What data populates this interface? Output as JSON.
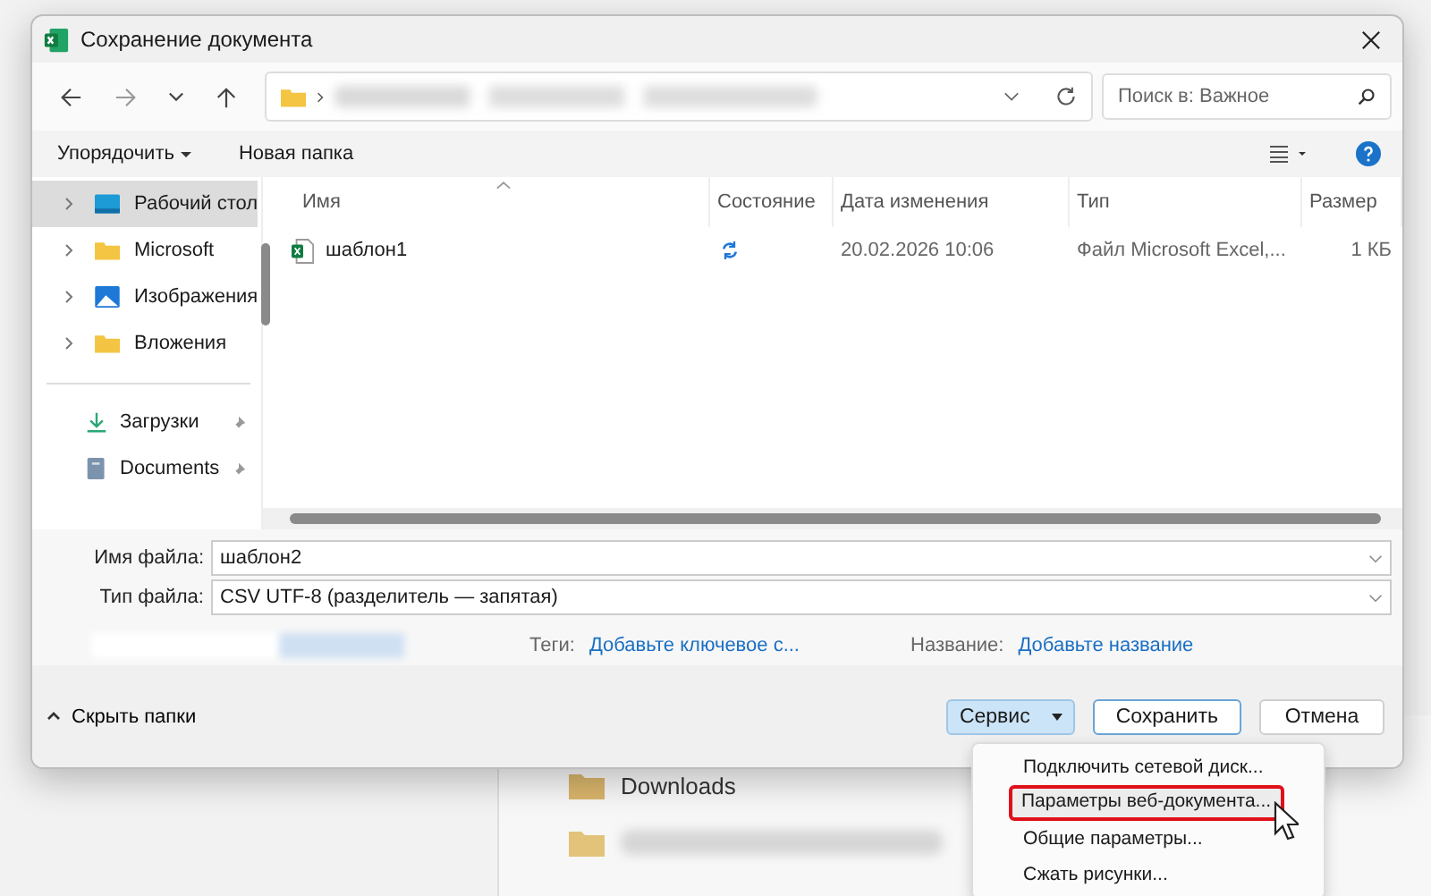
{
  "window": {
    "title": "Сохранение документа"
  },
  "search": {
    "placeholder": "Поиск в: Важное"
  },
  "toolbar": {
    "organize": "Упорядочить",
    "new_folder": "Новая папка"
  },
  "sidebar": {
    "items": [
      {
        "label": "Рабочий стол",
        "kind": "desktop",
        "selected": true,
        "expandable": true
      },
      {
        "label": "Microsoft",
        "kind": "folder",
        "selected": false,
        "expandable": true
      },
      {
        "label": "Изображения",
        "kind": "pictures",
        "selected": false,
        "expandable": true
      },
      {
        "label": "Вложения",
        "kind": "folder",
        "selected": false,
        "expandable": true
      }
    ],
    "quick": [
      {
        "label": "Загрузки",
        "kind": "download",
        "pinned": true
      },
      {
        "label": "Documents",
        "kind": "documents",
        "pinned": true
      }
    ]
  },
  "table": {
    "columns": [
      "Имя",
      "Состояние",
      "Дата изменения",
      "Тип",
      "Размер"
    ],
    "rows": [
      {
        "name": "шаблон1",
        "synced": true,
        "date": "20.02.2026 10:06",
        "type": "Файл Microsoft Excel,...",
        "size": "1 КБ"
      }
    ]
  },
  "form": {
    "filename_label": "Имя файла:",
    "filename": "шаблон2",
    "filetype_label": "Тип файла:",
    "filetype": "CSV UTF-8 (разделитель — запятая)",
    "tags_label": "Теги:",
    "tags_link": "Добавьте ключевое с...",
    "title_label": "Название:",
    "title_link": "Добавьте название"
  },
  "footer": {
    "hide_folders": "Скрыть папки",
    "tools": "Сервис",
    "save": "Сохранить",
    "cancel": "Отмена"
  },
  "menu": [
    {
      "label": "Подключить сетевой диск...",
      "highlighted": false
    },
    {
      "label": "Параметры веб-документа...",
      "highlighted": true
    },
    {
      "label": "Общие параметры...",
      "highlighted": false
    },
    {
      "label": "Сжать рисунки...",
      "highlighted": false
    }
  ],
  "background": {
    "items": [
      {
        "label": "Downloads"
      }
    ]
  }
}
